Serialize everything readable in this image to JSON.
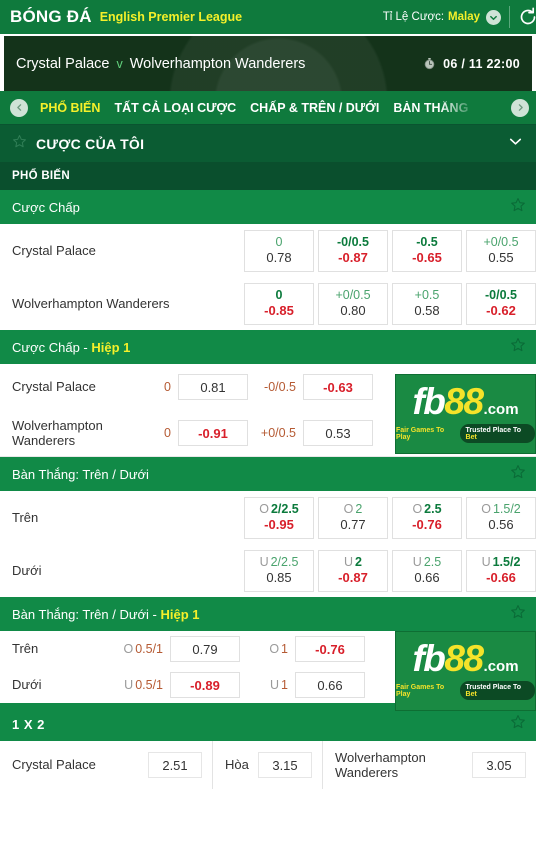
{
  "header": {
    "brand": "BÓNG ĐÁ",
    "league": "English Premier League",
    "odds_type_label": "Tỉ Lệ Cược:",
    "odds_type_value": "Malay",
    "chevron_icon": "chevron-down-icon",
    "refresh_icon": "refresh-icon"
  },
  "match": {
    "home": "Crystal Palace",
    "vs": "v",
    "away": "Wolverhampton Wanderers",
    "clock_icon": "stopwatch-icon",
    "time": "06 / 11 22:00"
  },
  "tabs": {
    "prev_icon": "chevron-left-icon",
    "next_icon": "chevron-right-icon",
    "items": [
      {
        "label": "PHỔ BIẾN",
        "active": true
      },
      {
        "label": "TẤT CẢ LOẠI CƯỢC",
        "active": false
      },
      {
        "label": "CHẤP & TRÊN / DƯỚI",
        "active": false
      },
      {
        "label": "BÀN THẮNG",
        "active": false
      }
    ]
  },
  "mybets": {
    "star_icon": "star-outline-icon",
    "title": "CƯỢC CỦA TÔI",
    "chevron_icon": "chevron-down-icon"
  },
  "popular": {
    "label": "PHỔ BIẾN"
  },
  "markets": [
    {
      "title": "Cược Chấp",
      "suffix": "",
      "rows": [
        {
          "label": "Crystal Palace",
          "cells": [
            {
              "hcap": "0",
              "hcap_style": "soft",
              "price": "0.78",
              "price_style": "pos"
            },
            {
              "hcap": "-0/0.5",
              "hcap_style": "strong",
              "price": "-0.87",
              "price_style": "neg"
            },
            {
              "hcap": "-0.5",
              "hcap_style": "strong",
              "price": "-0.65",
              "price_style": "neg"
            },
            {
              "hcap": "+0/0.5",
              "hcap_style": "soft",
              "price": "0.55",
              "price_style": "pos"
            }
          ]
        },
        {
          "label": "Wolverhampton Wanderers",
          "cells": [
            {
              "hcap": "0",
              "hcap_style": "strong",
              "price": "-0.85",
              "price_style": "neg"
            },
            {
              "hcap": "+0/0.5",
              "hcap_style": "soft",
              "price": "0.80",
              "price_style": "pos"
            },
            {
              "hcap": "+0.5",
              "hcap_style": "soft",
              "price": "0.58",
              "price_style": "pos"
            },
            {
              "hcap": "-0/0.5",
              "hcap_style": "strong",
              "price": "-0.62",
              "price_style": "neg"
            }
          ]
        }
      ]
    },
    {
      "title": "Bàn Thắng: Trên / Dưới",
      "suffix": "",
      "rows": [
        {
          "label": "Trên",
          "cells": [
            {
              "prefix": "O",
              "hcap": "2/2.5",
              "hcap_style": "strong",
              "price": "-0.95",
              "price_style": "neg"
            },
            {
              "prefix": "O",
              "hcap": "2",
              "hcap_style": "soft",
              "price": "0.77",
              "price_style": "pos"
            },
            {
              "prefix": "O",
              "hcap": "2.5",
              "hcap_style": "strong",
              "price": "-0.76",
              "price_style": "neg"
            },
            {
              "prefix": "O",
              "hcap": "1.5/2",
              "hcap_style": "soft",
              "price": "0.56",
              "price_style": "pos"
            }
          ]
        },
        {
          "label": "Dưới",
          "cells": [
            {
              "prefix": "U",
              "hcap": "2/2.5",
              "hcap_style": "soft",
              "price": "0.85",
              "price_style": "pos"
            },
            {
              "prefix": "U",
              "hcap": "2",
              "hcap_style": "strong",
              "price": "-0.87",
              "price_style": "neg"
            },
            {
              "prefix": "U",
              "hcap": "2.5",
              "hcap_style": "soft",
              "price": "0.66",
              "price_style": "pos"
            },
            {
              "prefix": "U",
              "hcap": "1.5/2",
              "hcap_style": "strong",
              "price": "-0.66",
              "price_style": "neg"
            }
          ]
        }
      ]
    }
  ],
  "market_handicap_h1": {
    "title": "Cược Chấp - ",
    "suffix": "Hiệp 1",
    "rows": [
      {
        "label": "Crystal Palace",
        "groups": [
          {
            "hcap": "0",
            "price": "0.81",
            "price_style": "pos"
          },
          {
            "hcap": "-0/0.5",
            "price": "-0.63",
            "price_style": "neg"
          }
        ]
      },
      {
        "label": "Wolverhampton Wanderers",
        "groups": [
          {
            "hcap": "0",
            "price": "-0.91",
            "price_style": "neg"
          },
          {
            "hcap": "+0/0.5",
            "price": "0.53",
            "price_style": "pos"
          }
        ]
      }
    ]
  },
  "market_ou_h1": {
    "title": "Bàn Thắng: Trên / Dưới - ",
    "suffix": "Hiệp 1",
    "rows": [
      {
        "label": "Trên",
        "groups": [
          {
            "prefix": "O",
            "hcap": "0.5/1",
            "price": "0.79",
            "price_style": "pos"
          },
          {
            "prefix": "O",
            "hcap": "1",
            "price": "-0.76",
            "price_style": "neg"
          }
        ]
      },
      {
        "label": "Dưới",
        "groups": [
          {
            "prefix": "U",
            "hcap": "0.5/1",
            "price": "-0.89",
            "price_style": "neg"
          },
          {
            "prefix": "U",
            "hcap": "1",
            "price": "0.66",
            "price_style": "pos"
          }
        ]
      }
    ]
  },
  "market_1x2": {
    "title": "1 X 2",
    "home_name": "Crystal Palace",
    "home_price": "2.51",
    "draw_name": "Hòa",
    "draw_price": "3.15",
    "away_name": "Wolverhampton Wanderers",
    "away_price": "3.05"
  },
  "fb88_banner": {
    "logo_fb": "fb",
    "logo_88": "88",
    "logo_com": ".com",
    "tagline_left": "Fair Games To Play",
    "tagline_right_pre": "Trusted Place To ",
    "tagline_right_hl": "Bet"
  },
  "colors": {
    "brand_green": "#0f7a3d",
    "header_green": "#118a47",
    "dark_green": "#0b5c33",
    "accent_yellow": "#f5f02a",
    "odds_green": "#0b7a3c",
    "odds_red": "#d81f2a",
    "hcap_orange": "#b55a33"
  }
}
